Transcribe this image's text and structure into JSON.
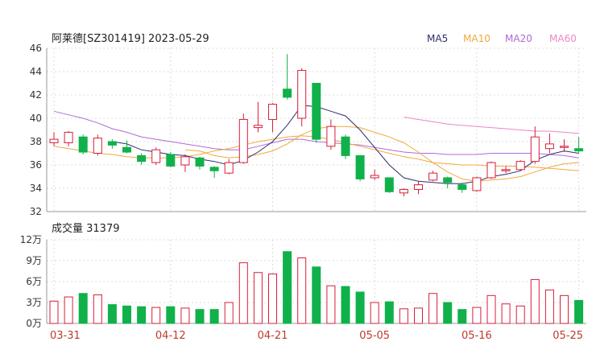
{
  "chart_data": {
    "type": "candlestick",
    "title": "阿莱德[SZ301419] 2023-05-29",
    "legend": [
      {
        "name": "MA5",
        "color": "#2c2f6b"
      },
      {
        "name": "MA10",
        "color": "#f3a83c"
      },
      {
        "name": "MA20",
        "color": "#b06ad6"
      },
      {
        "name": "MA60",
        "color": "#ea88c4"
      }
    ],
    "colors": {
      "up": "#d81e3a",
      "down": "#10b14a"
    },
    "price_axis": {
      "ylim": [
        32,
        46
      ],
      "ticks": [
        "46",
        "44",
        "42",
        "40",
        "38",
        "36",
        "34",
        "32"
      ]
    },
    "volume_title": "成交量 31379",
    "volume_axis": {
      "ylim": [
        0,
        12
      ],
      "ticks": [
        "12万",
        "9万",
        "6万",
        "3万",
        "0万"
      ]
    },
    "date_ticks": [
      {
        "label": "03-31",
        "index": 0
      },
      {
        "label": "04-12",
        "index": 8
      },
      {
        "label": "04-21",
        "index": 15
      },
      {
        "label": "05-05",
        "index": 22
      },
      {
        "label": "05-16",
        "index": 29
      },
      {
        "label": "05-25",
        "index": 36
      }
    ],
    "candles": [
      {
        "o": 37.9,
        "c": 38.2,
        "h": 38.8,
        "l": 37.6
      },
      {
        "o": 37.9,
        "c": 38.8,
        "h": 38.9,
        "l": 37.6
      },
      {
        "o": 38.4,
        "c": 37.1,
        "h": 38.6,
        "l": 36.9
      },
      {
        "o": 37.0,
        "c": 38.3,
        "h": 38.6,
        "l": 36.8
      },
      {
        "o": 38.0,
        "c": 37.7,
        "h": 38.2,
        "l": 37.4
      },
      {
        "o": 37.5,
        "c": 37.1,
        "h": 38.1,
        "l": 37.0
      },
      {
        "o": 36.8,
        "c": 36.3,
        "h": 37.0,
        "l": 36.0
      },
      {
        "o": 36.2,
        "c": 37.3,
        "h": 37.5,
        "l": 36.0
      },
      {
        "o": 36.9,
        "c": 35.9,
        "h": 37.1,
        "l": 35.8
      },
      {
        "o": 36.0,
        "c": 36.7,
        "h": 36.9,
        "l": 35.4
      },
      {
        "o": 36.6,
        "c": 35.9,
        "h": 36.7,
        "l": 35.6
      },
      {
        "o": 35.8,
        "c": 35.5,
        "h": 35.9,
        "l": 34.9
      },
      {
        "o": 35.3,
        "c": 36.2,
        "h": 36.5,
        "l": 35.2
      },
      {
        "o": 36.2,
        "c": 39.9,
        "h": 40.4,
        "l": 36.1
      },
      {
        "o": 39.2,
        "c": 39.4,
        "h": 41.4,
        "l": 38.8
      },
      {
        "o": 39.9,
        "c": 41.2,
        "h": 41.3,
        "l": 38.8
      },
      {
        "o": 42.5,
        "c": 41.8,
        "h": 45.5,
        "l": 41.6
      },
      {
        "o": 40.0,
        "c": 44.1,
        "h": 44.3,
        "l": 39.3
      },
      {
        "o": 43.0,
        "c": 38.2,
        "h": 43.0,
        "l": 37.9
      },
      {
        "o": 37.6,
        "c": 39.3,
        "h": 39.9,
        "l": 37.3
      },
      {
        "o": 38.4,
        "c": 36.8,
        "h": 38.6,
        "l": 36.5
      },
      {
        "o": 36.8,
        "c": 34.8,
        "h": 36.8,
        "l": 34.6
      },
      {
        "o": 34.9,
        "c": 35.1,
        "h": 35.6,
        "l": 34.7
      },
      {
        "o": 34.9,
        "c": 33.7,
        "h": 34.9,
        "l": 33.6
      },
      {
        "o": 33.6,
        "c": 33.9,
        "h": 34.0,
        "l": 33.3
      },
      {
        "o": 33.9,
        "c": 34.3,
        "h": 34.6,
        "l": 33.5
      },
      {
        "o": 34.7,
        "c": 35.3,
        "h": 35.5,
        "l": 34.6
      },
      {
        "o": 34.9,
        "c": 34.5,
        "h": 35.0,
        "l": 34.0
      },
      {
        "o": 34.3,
        "c": 33.9,
        "h": 34.5,
        "l": 33.6
      },
      {
        "o": 33.8,
        "c": 34.9,
        "h": 35.0,
        "l": 33.7
      },
      {
        "o": 34.9,
        "c": 36.2,
        "h": 36.3,
        "l": 34.8
      },
      {
        "o": 35.5,
        "c": 35.6,
        "h": 35.9,
        "l": 35.3
      },
      {
        "o": 35.6,
        "c": 36.3,
        "h": 36.4,
        "l": 35.5
      },
      {
        "o": 36.3,
        "c": 38.4,
        "h": 39.3,
        "l": 36.1
      },
      {
        "o": 37.4,
        "c": 37.8,
        "h": 38.7,
        "l": 37.0
      },
      {
        "o": 37.5,
        "c": 37.6,
        "h": 38.2,
        "l": 37.1
      },
      {
        "o": 37.4,
        "c": 37.2,
        "h": 38.4,
        "l": 37.0
      }
    ],
    "volumes": [
      3.2,
      3.8,
      4.3,
      4.1,
      2.7,
      2.5,
      2.4,
      2.3,
      2.4,
      2.2,
      2.0,
      2.0,
      3.0,
      8.7,
      7.3,
      7.1,
      10.3,
      9.4,
      8.1,
      5.4,
      5.3,
      4.5,
      3.0,
      3.1,
      2.1,
      2.2,
      4.3,
      3.0,
      2.0,
      2.3,
      4.0,
      2.8,
      2.5,
      6.3,
      4.8,
      4.0,
      3.3
    ],
    "ma5": [
      null,
      null,
      null,
      null,
      38.0,
      37.8,
      37.3,
      37.1,
      36.9,
      36.8,
      36.5,
      36.3,
      36.0,
      36.4,
      37.1,
      38.0,
      39.4,
      41.1,
      41.0,
      40.6,
      40.2,
      39.0,
      37.5,
      36.0,
      34.9,
      34.6,
      34.5,
      34.4,
      34.4,
      34.6,
      35.0,
      35.2,
      35.5,
      36.4,
      36.9,
      37.2,
      37.0
    ],
    "ma10": [
      null,
      null,
      null,
      null,
      null,
      null,
      null,
      null,
      null,
      37.3,
      37.2,
      36.8,
      36.6,
      36.7,
      36.9,
      37.2,
      37.8,
      38.6,
      39.1,
      39.3,
      39.3,
      39.2,
      38.8,
      38.4,
      37.9,
      37.1,
      36.2,
      35.4,
      34.8,
      34.6,
      34.7,
      34.8,
      35.0,
      35.4,
      35.8,
      36.1,
      36.2
    ],
    "ma20": [
      37.6,
      37.4,
      37.2,
      37.0,
      36.9,
      36.7,
      36.6,
      36.6,
      36.6,
      36.7,
      36.9,
      37.2,
      37.4,
      37.7,
      38.0,
      38.2,
      38.4,
      38.5,
      38.4,
      38.2,
      37.9,
      37.6,
      37.3,
      37.0,
      36.7,
      36.5,
      36.2,
      36.1,
      36.0,
      36.0,
      35.9,
      35.9,
      35.9,
      35.8,
      35.7,
      35.6,
      35.5
    ],
    "ma60": [
      40.6,
      40.3,
      40.0,
      39.6,
      39.1,
      38.8,
      38.4,
      38.2,
      38.0,
      37.8,
      37.6,
      37.4,
      37.3,
      37.3,
      37.6,
      37.9,
      38.2,
      38.2,
      38.0,
      37.9,
      37.8,
      37.7,
      37.5,
      37.3,
      37.1,
      37.0,
      37.0,
      36.9,
      36.9,
      36.9,
      37.0,
      37.0,
      37.0,
      37.0,
      36.9,
      36.8,
      36.6
    ],
    "ma60_overlay": [
      null,
      null,
      null,
      null,
      null,
      null,
      null,
      null,
      null,
      null,
      null,
      null,
      null,
      null,
      null,
      null,
      null,
      null,
      null,
      null,
      null,
      null,
      null,
      null,
      40.1,
      39.9,
      39.7,
      39.5,
      39.4,
      39.3,
      39.2,
      39.1,
      39.0,
      38.9,
      38.9,
      38.8,
      38.7
    ]
  }
}
